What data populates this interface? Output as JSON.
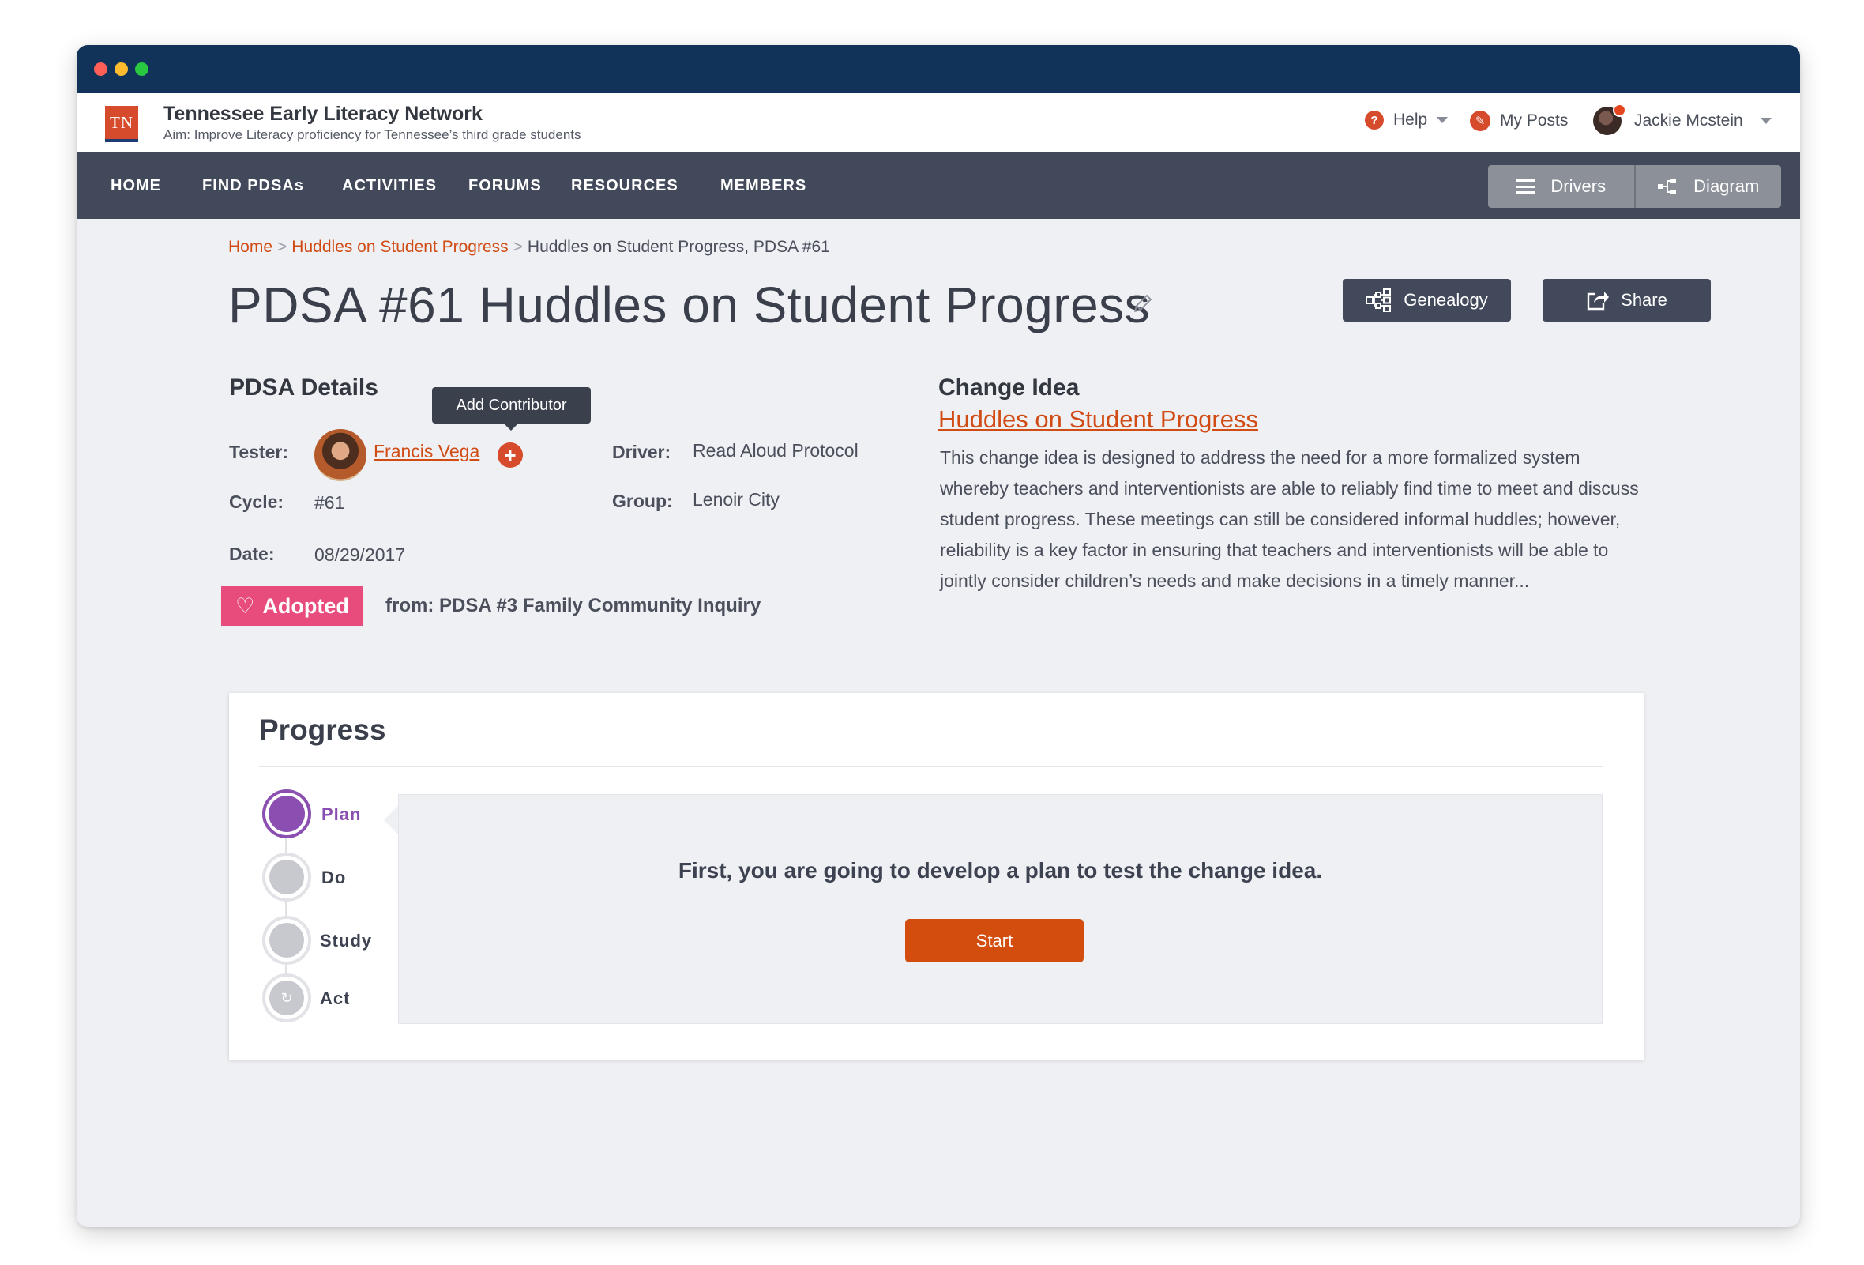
{
  "colors": {
    "titlebar": "#11335a",
    "navbar": "#42495b",
    "accent": "#d14b14",
    "adopted": "#e84c7d",
    "plan_active": "#8a4fb0",
    "window_dot_red": "#ff5f57",
    "window_dot_yellow": "#febc2e",
    "window_dot_green": "#28c840"
  },
  "header": {
    "logo_text": "TN",
    "org_name": "Tennessee Early Literacy Network",
    "aim": "Aim: Improve Literacy proficiency for Tennessee’s third grade students",
    "help_label": "Help",
    "my_posts_label": "My Posts",
    "user_name": "Jackie Mcstein"
  },
  "nav": {
    "items": [
      "HOME",
      "FIND PDSAs",
      "ACTIVITIES",
      "FORUMS",
      "RESOURCES",
      "MEMBERS"
    ],
    "toggle": {
      "drivers": "Drivers",
      "diagram": "Diagram"
    }
  },
  "breadcrumb": {
    "home": "Home",
    "sep": ">",
    "parent": "Huddles on Student Progress",
    "current": "Huddles on Student Progress, PDSA #61"
  },
  "page": {
    "title": "PDSA #61 Huddles on Student Progress",
    "genealogy_label": "Genealogy",
    "share_label": "Share"
  },
  "details": {
    "heading": "PDSA Details",
    "tooltip": "Add Contributor",
    "tester_label": "Tester:",
    "tester_name": "Francis Vega",
    "cycle_label": "Cycle:",
    "cycle_value": "#61",
    "date_label": "Date:",
    "date_value": "08/29/2017",
    "driver_label": "Driver:",
    "driver_value": "Read Aloud Protocol",
    "group_label": "Group:",
    "group_value": "Lenoir City",
    "adopted_label": "Adopted",
    "adopted_from": "from: PDSA #3 Family Community Inquiry"
  },
  "change_idea": {
    "heading": "Change Idea",
    "link": "Huddles on Student Progress",
    "description": "This change idea is designed to address the need for a more formalized system whereby teachers and interventionists are able to reliably find time to meet and discuss student progress. These meetings can still be considered informal huddles; however, reliability is a key factor in ensuring that teachers and interventionists will be able to jointly consider children’s needs and make decisions in a timely manner..."
  },
  "progress": {
    "heading": "Progress",
    "steps": [
      {
        "label": "Plan",
        "state": "active"
      },
      {
        "label": "Do",
        "state": "inactive"
      },
      {
        "label": "Study",
        "state": "inactive"
      },
      {
        "label": "Act",
        "state": "inactive"
      }
    ],
    "message": "First, you are going to develop a plan to test the change idea.",
    "start_label": "Start"
  }
}
